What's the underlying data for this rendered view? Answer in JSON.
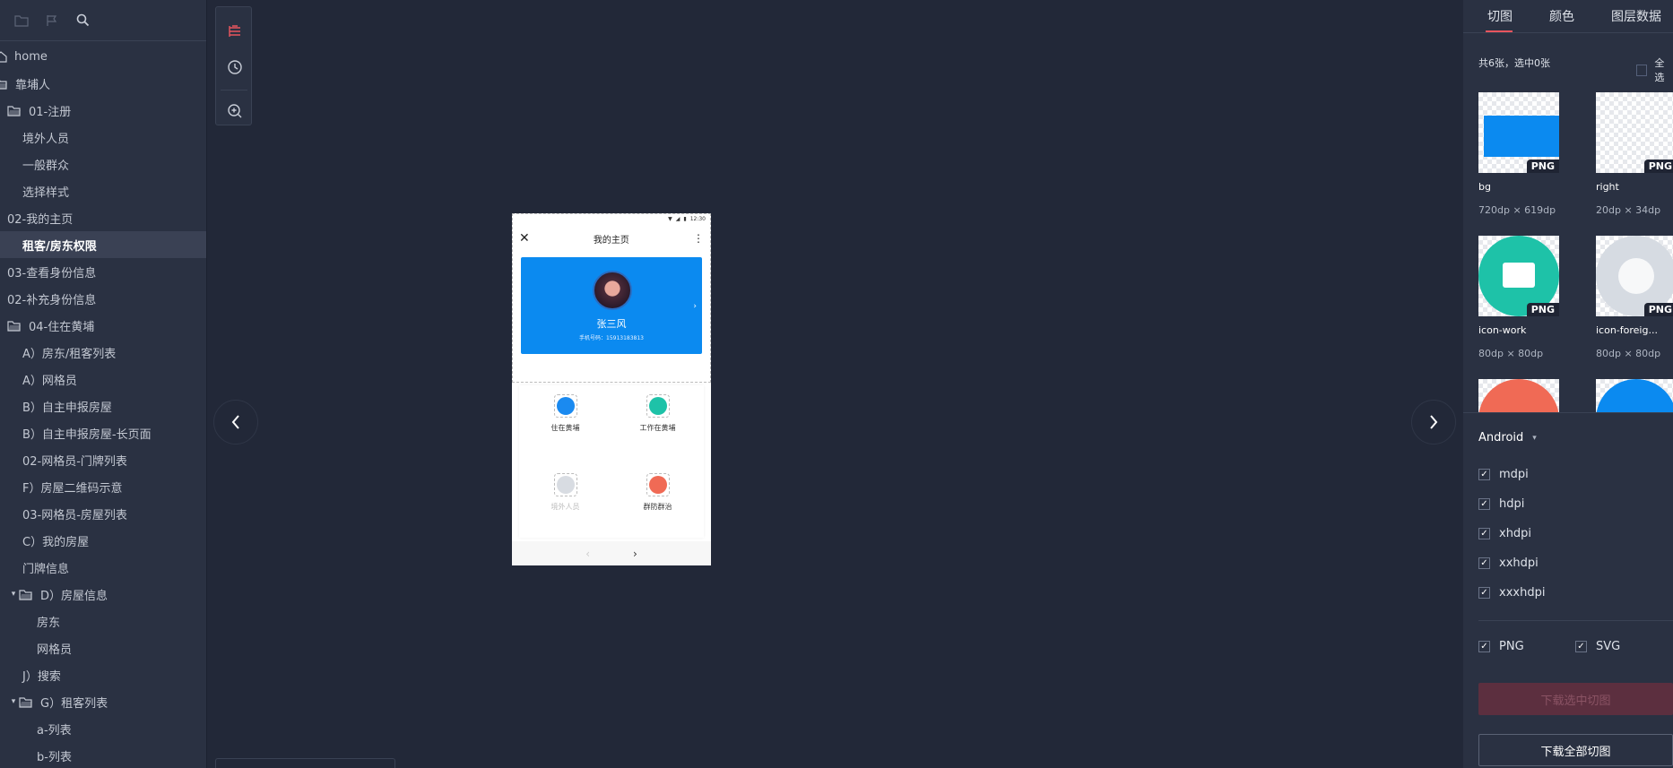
{
  "sidebar": {
    "tree": [
      {
        "label": "home",
        "indent": 0,
        "icon": "home-icon"
      },
      {
        "label": "靠埔人",
        "indent": 0,
        "icon": "folder-open-icon"
      },
      {
        "label": "01-注册",
        "indent": 1,
        "icon": "folder-open-icon"
      },
      {
        "label": "境外人员",
        "indent": 2
      },
      {
        "label": "一般群众",
        "indent": 2
      },
      {
        "label": "选择样式",
        "indent": 2
      },
      {
        "label": "02-我的主页",
        "indent": 1
      },
      {
        "label": "租客/房东权限",
        "indent": 2,
        "active": true
      },
      {
        "label": "03-查看身份信息",
        "indent": 1
      },
      {
        "label": "02-补充身份信息",
        "indent": 1
      },
      {
        "label": "04-住在黄埔",
        "indent": 1,
        "icon": "folder-open-icon"
      },
      {
        "label": "A）房东/租客列表",
        "indent": 2
      },
      {
        "label": "A）网格员",
        "indent": 2
      },
      {
        "label": "B）自主申报房屋",
        "indent": 2
      },
      {
        "label": "B）自主申报房屋-长页面",
        "indent": 2
      },
      {
        "label": "02-网格员-门牌列表",
        "indent": 2
      },
      {
        "label": "F）房屋二维码示意",
        "indent": 2
      },
      {
        "label": "03-网格员-房屋列表",
        "indent": 2
      },
      {
        "label": "C）我的房屋",
        "indent": 2
      },
      {
        "label": "门牌信息",
        "indent": 2
      },
      {
        "label": "D）房屋信息",
        "indent": 2,
        "icon": "folder-open-icon",
        "caret": "▾"
      },
      {
        "label": "房东",
        "indent": 3
      },
      {
        "label": "网格员",
        "indent": 3
      },
      {
        "label": "J）搜索",
        "indent": 2
      },
      {
        "label": "G）租客列表",
        "indent": 2,
        "icon": "folder-open-icon",
        "caret": "▾"
      },
      {
        "label": "a-列表",
        "indent": 3
      },
      {
        "label": "b-列表",
        "indent": 3
      }
    ]
  },
  "phone": {
    "time": "12:30",
    "title": "我的主页",
    "name": "张三风",
    "phone_line": "手机号码：15913183813",
    "grid": [
      {
        "label": "住在黄埔",
        "color": "#1a8af0"
      },
      {
        "label": "工作在黄埔",
        "color": "#1ec2a8"
      },
      {
        "label": "境外人员",
        "color": "#d8dce2",
        "muted": true
      },
      {
        "label": "群防群治",
        "color": "#f06a55"
      }
    ],
    "prev": "‹",
    "next": "›"
  },
  "right_panel": {
    "tabs": [
      "切图",
      "颜色",
      "图层数据"
    ],
    "count_text": "共6张，选中0张",
    "select_all": "全选",
    "slices": [
      {
        "name": "bg",
        "size": "720dp × 619dp",
        "badge": "PNG"
      },
      {
        "name": "right",
        "size": "20dp × 34dp",
        "badge": "PNG"
      },
      {
        "name": "icon-work",
        "size": "80dp × 80dp",
        "badge": "PNG"
      },
      {
        "name": "icon-foreig...",
        "size": "80dp × 80dp",
        "badge": "PNG"
      }
    ],
    "platform": "Android",
    "densities": [
      "mdpi",
      "hdpi",
      "xhdpi",
      "xxhdpi",
      "xxxhdpi"
    ],
    "formats": [
      "PNG",
      "SVG"
    ],
    "download_selected": "下载选中切图",
    "download_all": "下载全部切图"
  },
  "colors": {
    "accent": "#e8555e",
    "canvas": "#222838",
    "panel": "#2a3142",
    "phone_blue": "#0b8af0"
  }
}
